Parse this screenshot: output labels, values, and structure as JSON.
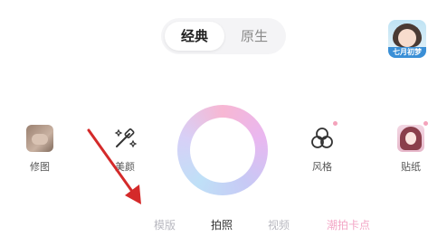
{
  "segment": {
    "classic_label": "经典",
    "native_label": "原生"
  },
  "avatar": {
    "tag": "七月初梦"
  },
  "tools": {
    "retouch_label": "修图",
    "beauty_label": "美颜",
    "style_label": "风格",
    "sticker_label": "贴纸"
  },
  "modes": {
    "template": "模版",
    "photo": "拍照",
    "video": "视频",
    "card": "潮拍卡点"
  },
  "colors": {
    "accent_pink": "#f3a6c6",
    "annotation_red": "#d42a2a"
  }
}
